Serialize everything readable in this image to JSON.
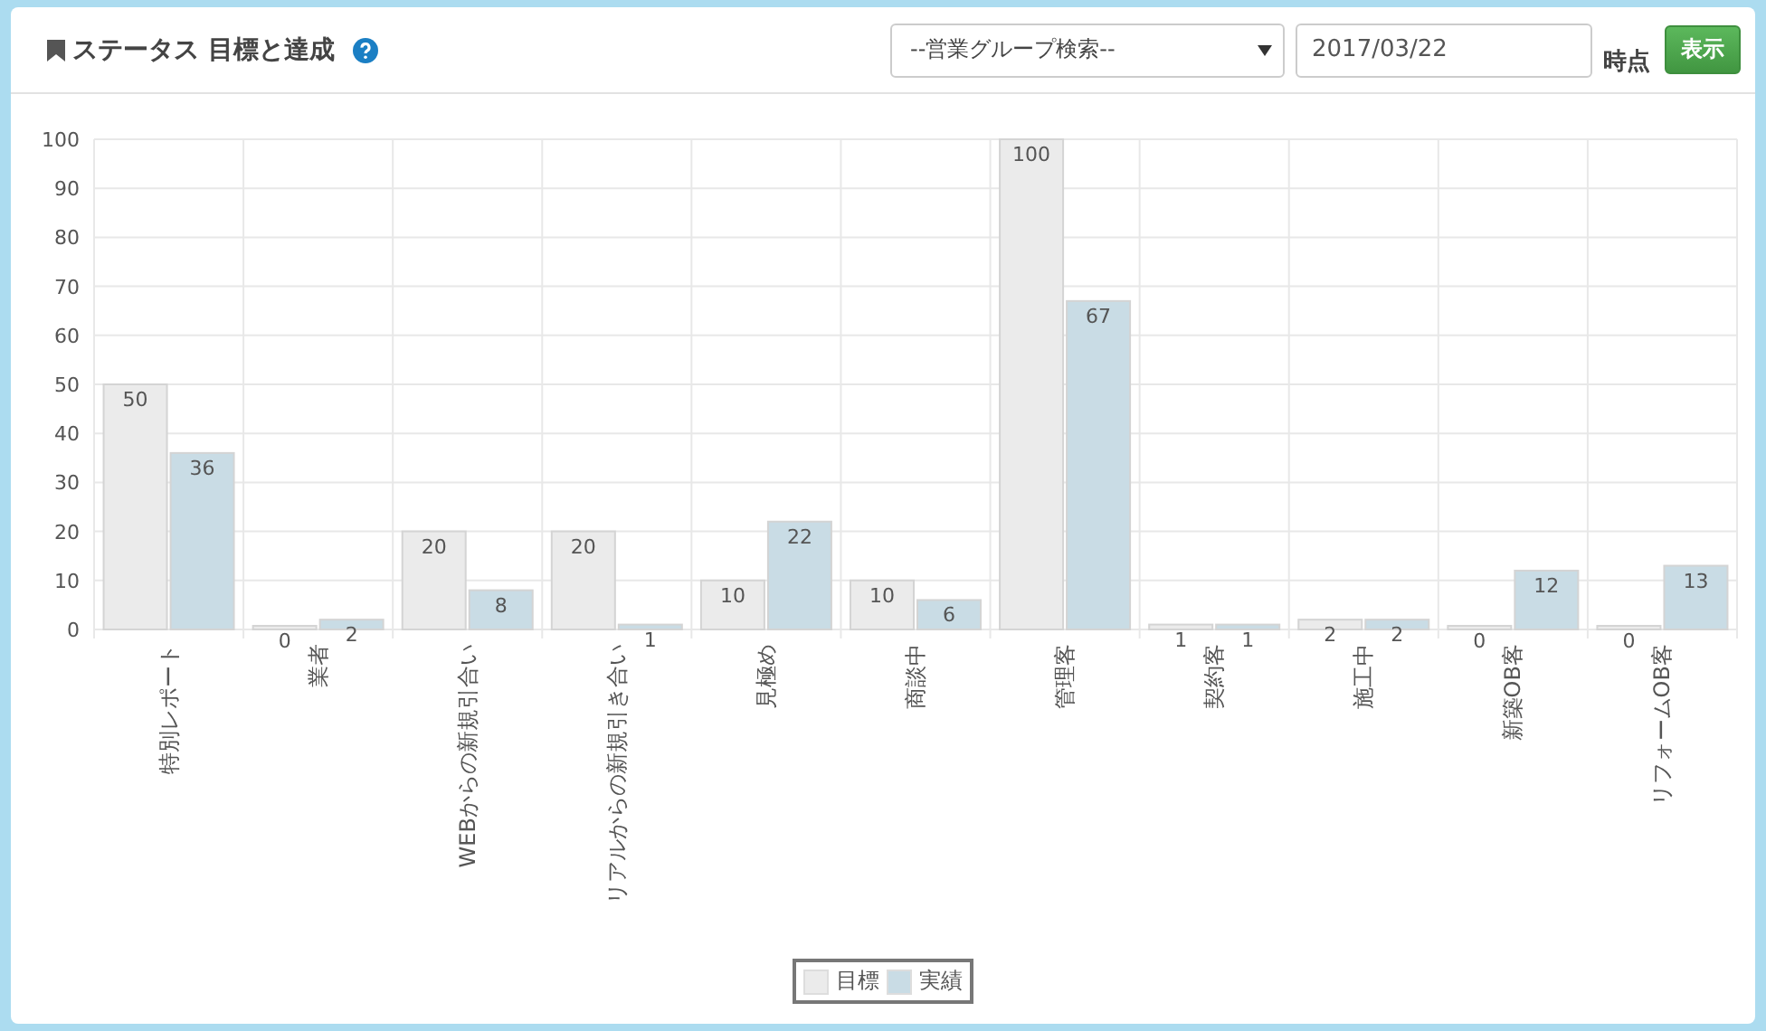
{
  "header": {
    "title": "ステータス 目標と達成",
    "group_select": {
      "value": "--営業グループ検索--"
    },
    "date_field": {
      "value": "2017/03/22"
    },
    "date_suffix": "時点",
    "show_button": "表示"
  },
  "chart": {
    "chart_data": {
      "type": "bar",
      "categories": [
        "特別レポート",
        "業者",
        "WEBからの新規引合い",
        "リアルからの新規引き合い",
        "見極め",
        "商談中",
        "管理客",
        "契約客",
        "施工中",
        "新築OB客",
        "リフォームOB客"
      ],
      "series": [
        {
          "name": "目標",
          "color": "#ebebeb",
          "values": [
            50,
            0,
            20,
            20,
            10,
            10,
            100,
            1,
            2,
            0,
            0
          ]
        },
        {
          "name": "実績",
          "color": "#c9dce5",
          "values": [
            36,
            2,
            8,
            1,
            22,
            6,
            67,
            1,
            2,
            12,
            13
          ]
        }
      ],
      "ylim": [
        0,
        100
      ],
      "yticks": [
        0,
        10,
        20,
        30,
        40,
        50,
        60,
        70,
        80,
        90,
        100
      ],
      "data_labels": true,
      "grid": true
    }
  }
}
